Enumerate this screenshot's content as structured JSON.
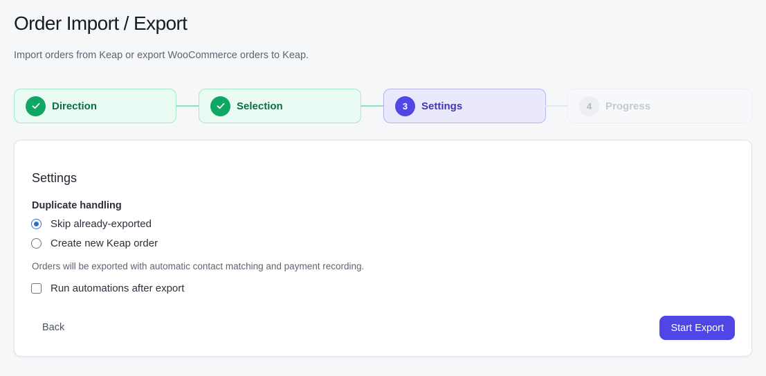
{
  "header": {
    "title": "Order Import / Export",
    "subtitle": "Import orders from Keap or export WooCommerce orders to Keap."
  },
  "stepper": {
    "steps": [
      {
        "number": "1",
        "label": "Direction",
        "status": "done"
      },
      {
        "number": "2",
        "label": "Selection",
        "status": "done"
      },
      {
        "number": "3",
        "label": "Settings",
        "status": "current"
      },
      {
        "number": "4",
        "label": "Progress",
        "status": "pending"
      }
    ],
    "done_icon": "check-icon"
  },
  "settings": {
    "title": "Settings",
    "duplicate_label": "Duplicate handling",
    "options": [
      {
        "label": "Skip already-exported",
        "checked": true
      },
      {
        "label": "Create new Keap order",
        "checked": false
      }
    ],
    "help_text": "Orders will be exported with automatic contact matching and payment recording.",
    "automations_label": "Run automations after export",
    "automations_checked": false
  },
  "actions": {
    "back_label": "Back",
    "start_label": "Start Export"
  },
  "colors": {
    "accent": "#4f46e5",
    "success": "#10a664"
  }
}
